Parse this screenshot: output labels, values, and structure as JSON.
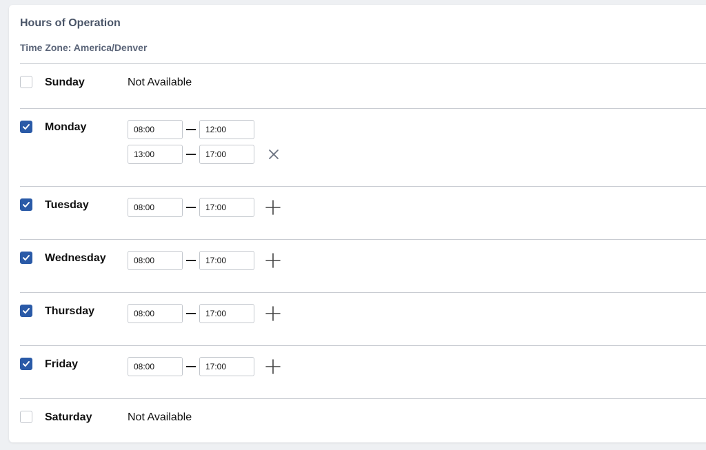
{
  "card": {
    "title": "Hours of Operation",
    "timezone_label": "Time Zone: America/Denver"
  },
  "colors": {
    "accent": "#2a5aa7",
    "title": "#4a5568",
    "divider": "#c9ccd2"
  },
  "days": [
    {
      "name": "Sunday",
      "enabled": false,
      "status": "Not Available",
      "ranges": []
    },
    {
      "name": "Monday",
      "enabled": true,
      "ranges": [
        {
          "start": "08:00",
          "end": "12:00"
        },
        {
          "start": "13:00",
          "end": "17:00"
        }
      ],
      "action_icon": "close-icon"
    },
    {
      "name": "Tuesday",
      "enabled": true,
      "ranges": [
        {
          "start": "08:00",
          "end": "17:00"
        }
      ],
      "action_icon": "plus-icon"
    },
    {
      "name": "Wednesday",
      "enabled": true,
      "ranges": [
        {
          "start": "08:00",
          "end": "17:00"
        }
      ],
      "action_icon": "plus-icon"
    },
    {
      "name": "Thursday",
      "enabled": true,
      "ranges": [
        {
          "start": "08:00",
          "end": "17:00"
        }
      ],
      "action_icon": "plus-icon"
    },
    {
      "name": "Friday",
      "enabled": true,
      "ranges": [
        {
          "start": "08:00",
          "end": "17:00"
        }
      ],
      "action_icon": "plus-icon"
    },
    {
      "name": "Saturday",
      "enabled": false,
      "status": "Not Available",
      "ranges": []
    }
  ]
}
